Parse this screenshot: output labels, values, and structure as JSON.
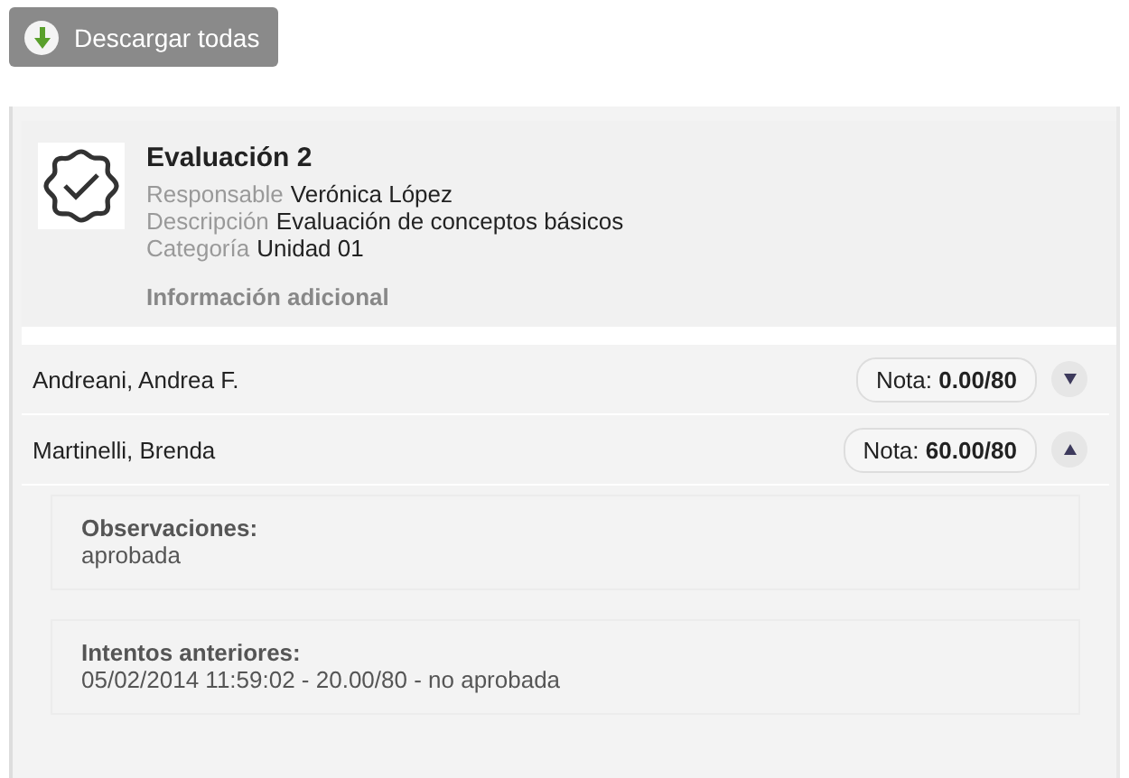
{
  "download_button": {
    "label": "Descargar todas"
  },
  "evaluation": {
    "title": "Evaluación 2",
    "fields": [
      {
        "label": "Responsable",
        "value": "Verónica López"
      },
      {
        "label": "Descripción",
        "value": "Evaluación de conceptos básicos"
      },
      {
        "label": "Categoría",
        "value": "Unidad 01"
      }
    ],
    "extra_link": "Información adicional"
  },
  "students": [
    {
      "name": "Andreani, Andrea F.",
      "grade": "Nota: **0.00/80**",
      "expanded": false
    },
    {
      "name": "Martinelli, Brenda",
      "grade": "Nota: **60.00/80**",
      "expanded": true,
      "sections": [
        {
          "title": "Observaciones:",
          "text": "aprobada"
        },
        {
          "title": "Intentos anteriores:",
          "text": "05/02/2014 11:59:02 - 20.00/80 - no aprobada"
        }
      ]
    }
  ]
}
